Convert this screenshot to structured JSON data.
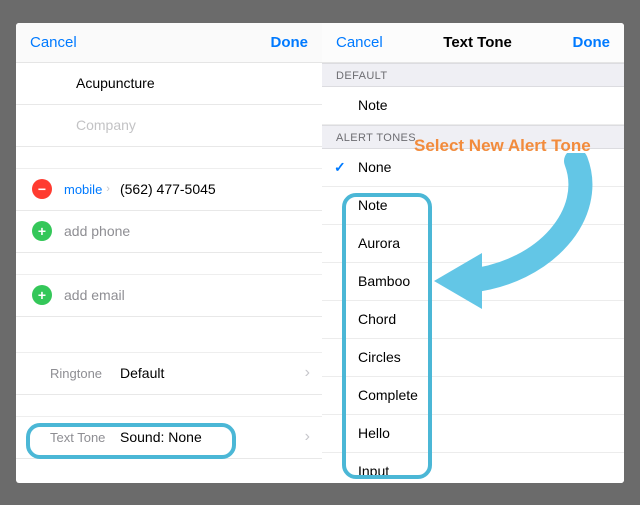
{
  "left": {
    "nav": {
      "cancel": "Cancel",
      "done": "Done"
    },
    "contact_name": "Acupuncture",
    "company_placeholder": "Company",
    "phone": {
      "type": "mobile",
      "value": "(562) 477-5045"
    },
    "add_phone": "add phone",
    "add_email": "add email",
    "ringtone": {
      "label": "Ringtone",
      "value": "Default"
    },
    "texttone": {
      "label": "Text Tone",
      "value": "Sound: None"
    }
  },
  "right": {
    "nav": {
      "cancel": "Cancel",
      "title": "Text Tone",
      "done": "Done"
    },
    "section_default": "DEFAULT",
    "default_tone": "Note",
    "section_alert": "ALERT TONES",
    "selected": "None",
    "tones": [
      "Note",
      "Aurora",
      "Bamboo",
      "Chord",
      "Circles",
      "Complete",
      "Hello",
      "Input"
    ]
  },
  "annotation": {
    "callout": "Select New Alert Tone"
  }
}
